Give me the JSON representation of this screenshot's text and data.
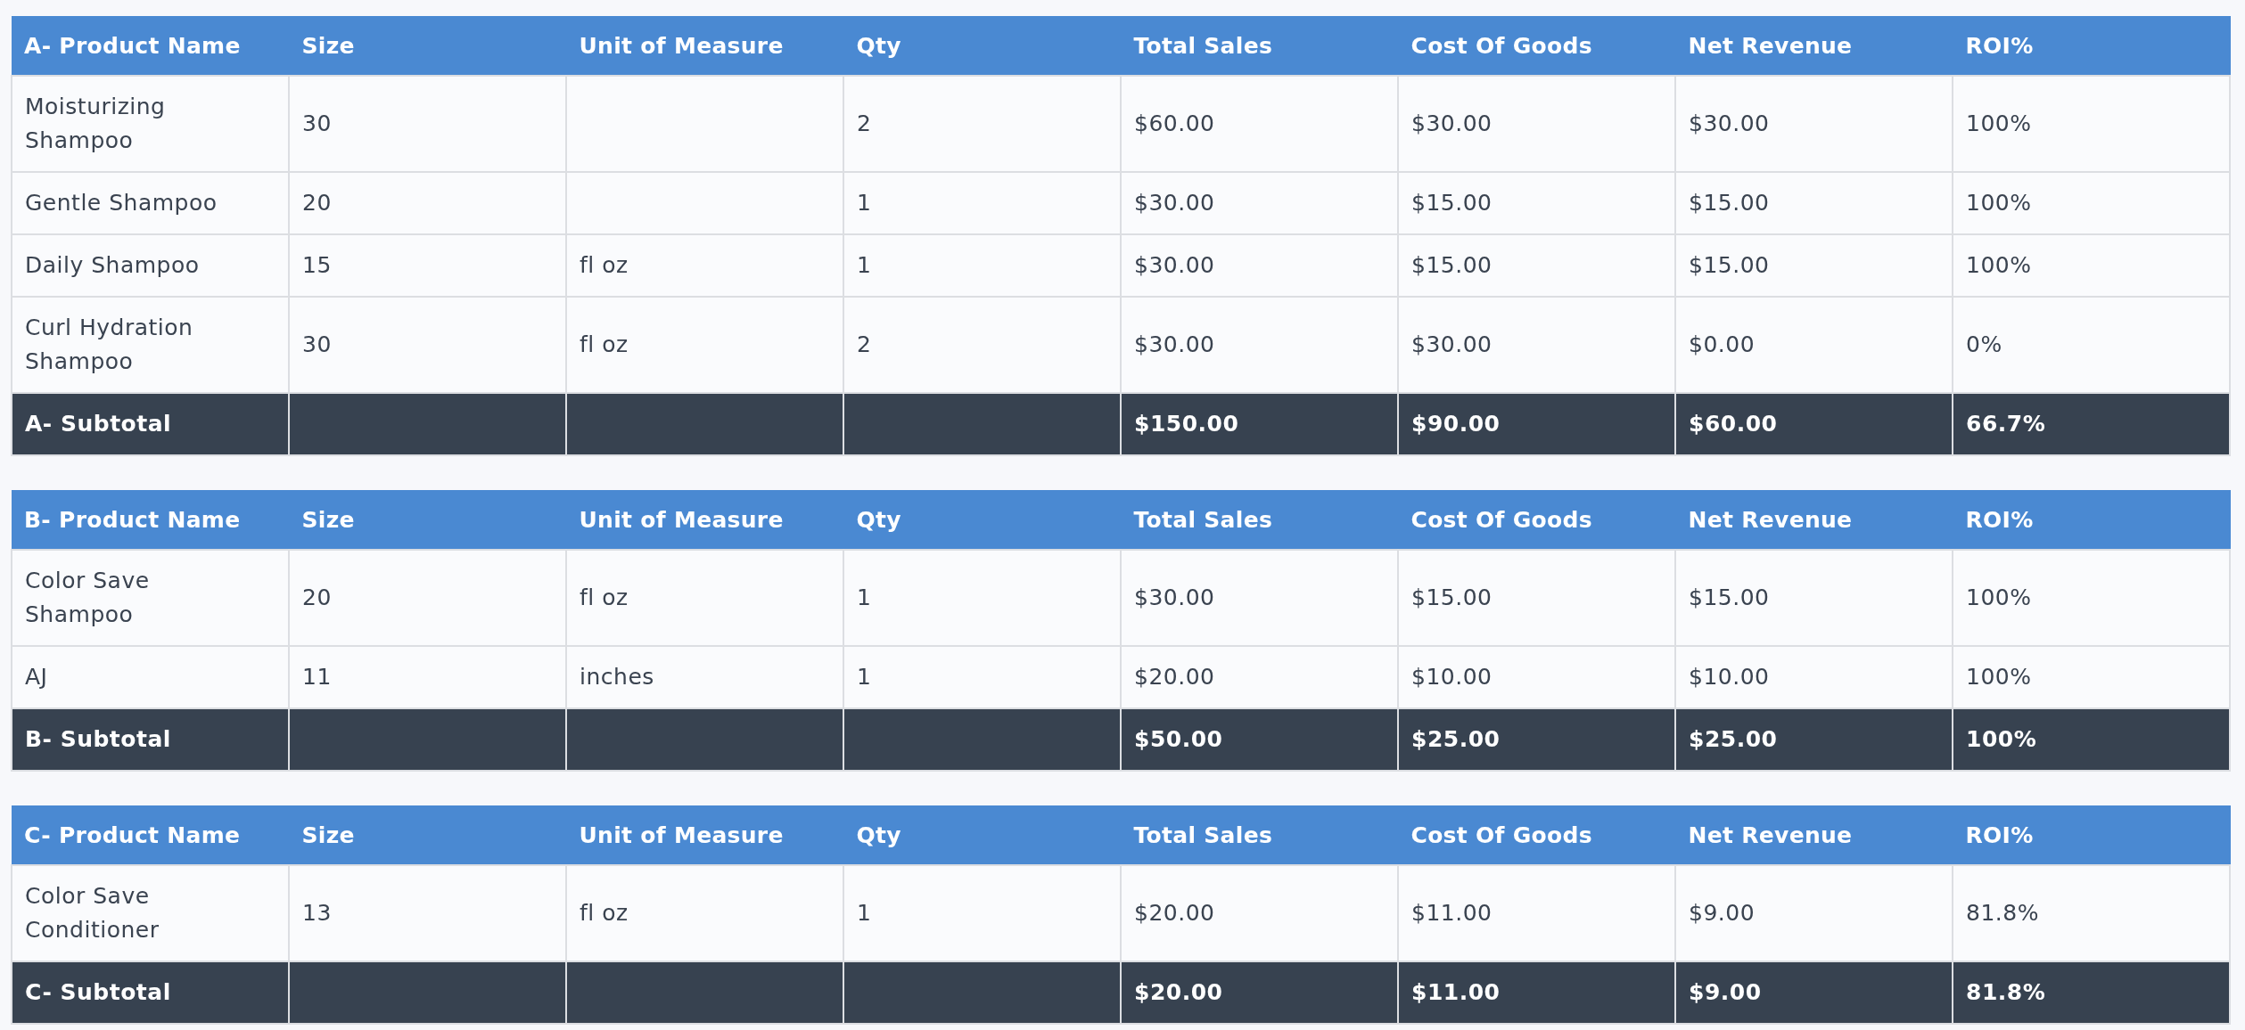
{
  "sections": [
    {
      "columns": [
        "A- Product Name",
        "Size",
        "Unit of Measure",
        "Qty",
        "Total Sales",
        "Cost Of Goods",
        "Net Revenue",
        "ROI%"
      ],
      "rows": [
        {
          "product_name": "Moisturizing Shampoo",
          "size": "30",
          "qty": "2",
          "total_sales": "$60.00",
          "cost_of_goods": "$30.00",
          "net_revenue": "$30.00",
          "roi": "100%"
        },
        {
          "product_name": "Gentle Shampoo",
          "size": "20",
          "qty": "1",
          "total_sales": "$30.00",
          "cost_of_goods": "$15.00",
          "net_revenue": "$15.00",
          "roi": "100%"
        },
        {
          "product_name": "Daily Shampoo",
          "size": "15",
          "unit_of_measure": "fl oz",
          "qty": "1",
          "total_sales": "$30.00",
          "cost_of_goods": "$15.00",
          "net_revenue": "$15.00",
          "roi": "100%"
        },
        {
          "product_name": "Curl Hydration Shampoo",
          "size": "30",
          "unit_of_measure": "fl oz",
          "qty": "2",
          "total_sales": "$30.00",
          "cost_of_goods": "$30.00",
          "net_revenue": "$0.00",
          "roi": "0%"
        }
      ],
      "subtotal": {
        "product_name": "A- Subtotal",
        "total_sales": "$150.00",
        "cost_of_goods": "$90.00",
        "net_revenue": "$60.00",
        "roi": "66.7%"
      }
    },
    {
      "columns": [
        "B- Product Name",
        "Size",
        "Unit of Measure",
        "Qty",
        "Total Sales",
        "Cost Of Goods",
        "Net Revenue",
        "ROI%"
      ],
      "rows": [
        {
          "product_name": "Color Save Shampoo",
          "size": "20",
          "unit_of_measure": "fl oz",
          "qty": "1",
          "total_sales": "$30.00",
          "cost_of_goods": "$15.00",
          "net_revenue": "$15.00",
          "roi": "100%"
        },
        {
          "product_name": "AJ",
          "size": "11",
          "unit_of_measure": "inches",
          "qty": "1",
          "total_sales": "$20.00",
          "cost_of_goods": "$10.00",
          "net_revenue": "$10.00",
          "roi": "100%"
        }
      ],
      "subtotal": {
        "product_name": "B- Subtotal",
        "total_sales": "$50.00",
        "cost_of_goods": "$25.00",
        "net_revenue": "$25.00",
        "roi": "100%"
      }
    },
    {
      "columns": [
        "C- Product Name",
        "Size",
        "Unit of Measure",
        "Qty",
        "Total Sales",
        "Cost Of Goods",
        "Net Revenue",
        "ROI%"
      ],
      "rows": [
        {
          "product_name": "Color Save Conditioner",
          "size": "13",
          "unit_of_measure": "fl oz",
          "qty": "1",
          "total_sales": "$20.00",
          "cost_of_goods": "$11.00",
          "net_revenue": "$9.00",
          "roi": "81.8%"
        }
      ],
      "subtotal": {
        "product_name": "C- Subtotal",
        "total_sales": "$20.00",
        "cost_of_goods": "$11.00",
        "net_revenue": "$9.00",
        "roi": "81.8%"
      }
    }
  ]
}
